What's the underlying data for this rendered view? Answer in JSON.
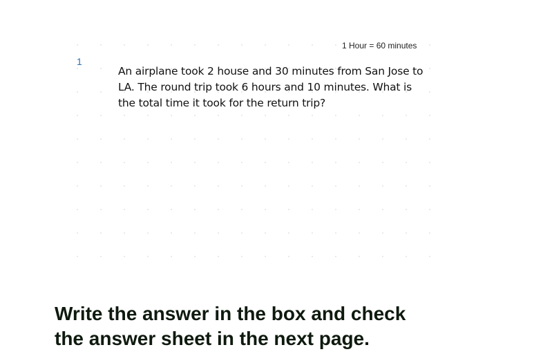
{
  "worksheet": {
    "conversion_note": "1 Hour = 60 minutes",
    "question": {
      "number": "1",
      "lines": [
        "An airplane took 2 house and 30 minutes from San Jose to",
        "LA. The round trip took 6 hours and 10 minutes. What is",
        "the total time it took for the return trip?"
      ]
    },
    "instruction_lines": [
      "Write the answer in the box and check",
      "the answer sheet in the next page."
    ]
  }
}
